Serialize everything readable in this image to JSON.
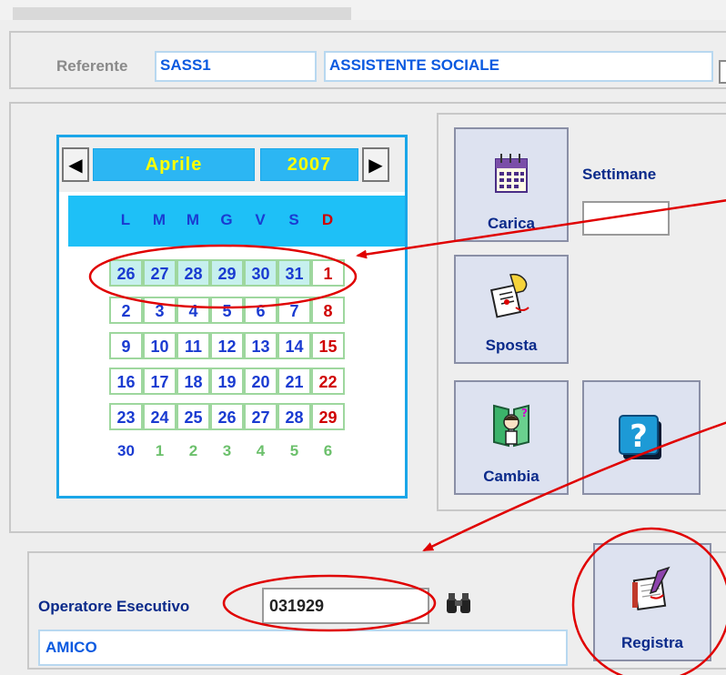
{
  "referente": {
    "label": "Referente",
    "code": "SASS1",
    "description": "ASSISTENTE SOCIALE"
  },
  "calendar": {
    "month": "Aprile",
    "year": "2007",
    "weekdays": [
      "L",
      "M",
      "M",
      "G",
      "V",
      "S",
      "D"
    ],
    "weeks": [
      [
        "26",
        "27",
        "28",
        "29",
        "30",
        "31",
        "1"
      ],
      [
        "2",
        "3",
        "4",
        "5",
        "6",
        "7",
        "8"
      ],
      [
        "9",
        "10",
        "11",
        "12",
        "13",
        "14",
        "15"
      ],
      [
        "16",
        "17",
        "18",
        "19",
        "20",
        "21",
        "22"
      ],
      [
        "23",
        "24",
        "25",
        "26",
        "27",
        "28",
        "29"
      ],
      [
        "30",
        "1",
        "2",
        "3",
        "4",
        "5",
        "6"
      ]
    ]
  },
  "buttons": {
    "carica": "Carica",
    "sposta": "Sposta",
    "cambia": "Cambia",
    "registra": "Registra"
  },
  "settimane": {
    "label": "Settimane",
    "value": ""
  },
  "operatore": {
    "label": "Operatore Esecutivo",
    "code": "031929",
    "name": "AMICO"
  },
  "colors": {
    "accent_blue": "#1aa6e8",
    "annotation_red": "#e00000",
    "sunday_red": "#d00000"
  }
}
